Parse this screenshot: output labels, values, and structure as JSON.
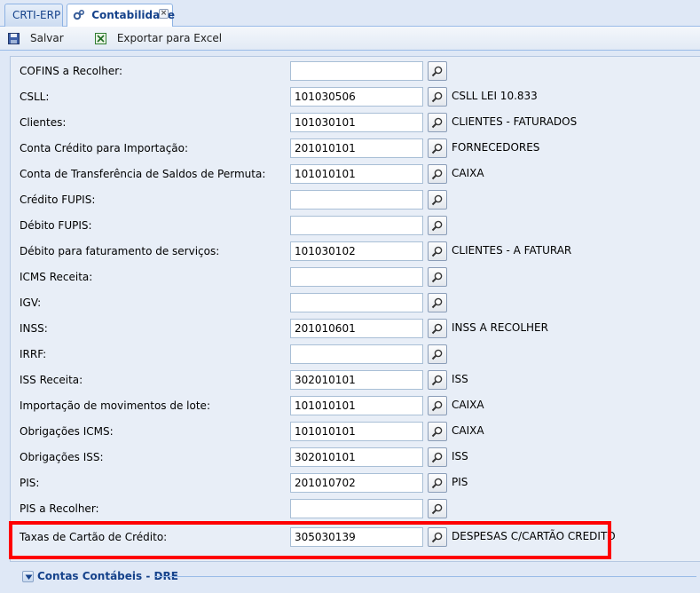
{
  "tabs": [
    {
      "label": "CRTI-ERP",
      "active": false
    },
    {
      "label": "Contabilidade",
      "active": true,
      "icon": "gears-icon",
      "closable": true
    }
  ],
  "toolbar": {
    "save_label": "Salvar",
    "export_label": "Exportar para Excel"
  },
  "form": {
    "rows": [
      {
        "label": "COFINS a Recolher:",
        "value": "",
        "description": ""
      },
      {
        "label": "CSLL:",
        "value": "101030506",
        "description": "CSLL LEI 10.833"
      },
      {
        "label": "Clientes:",
        "value": "101030101",
        "description": "CLIENTES - FATURADOS"
      },
      {
        "label": "Conta Crédito para Importação:",
        "value": "201010101",
        "description": "FORNECEDORES"
      },
      {
        "label": "Conta de Transferência de Saldos de Permuta:",
        "value": "101010101",
        "description": "CAIXA"
      },
      {
        "label": "Crédito FUPIS:",
        "value": "",
        "description": ""
      },
      {
        "label": "Débito FUPIS:",
        "value": "",
        "description": ""
      },
      {
        "label": "Débito para faturamento de serviços:",
        "value": "101030102",
        "description": "CLIENTES - A FATURAR"
      },
      {
        "label": "ICMS Receita:",
        "value": "",
        "description": ""
      },
      {
        "label": "IGV:",
        "value": "",
        "description": ""
      },
      {
        "label": "INSS:",
        "value": "201010601",
        "description": "INSS A RECOLHER"
      },
      {
        "label": "IRRF:",
        "value": "",
        "description": ""
      },
      {
        "label": "ISS Receita:",
        "value": "302010101",
        "description": "ISS"
      },
      {
        "label": "Importação de movimentos de lote:",
        "value": "101010101",
        "description": "CAIXA"
      },
      {
        "label": "Obrigações ICMS:",
        "value": "101010101",
        "description": "CAIXA"
      },
      {
        "label": "Obrigações ISS:",
        "value": "302010101",
        "description": "ISS"
      },
      {
        "label": "PIS:",
        "value": "201010702",
        "description": "PIS"
      },
      {
        "label": "PIS a Recolher:",
        "value": "",
        "description": ""
      },
      {
        "label": "Taxas de Cartão de Crédito:",
        "value": "305030139",
        "description": "DESPESAS C/CARTÃO CREDITO"
      }
    ]
  },
  "section": {
    "title": "Contas Contábeis - DRE"
  },
  "colors": {
    "highlight": "#ff0000",
    "accent": "#15428b",
    "background": "#dfe8f6"
  }
}
